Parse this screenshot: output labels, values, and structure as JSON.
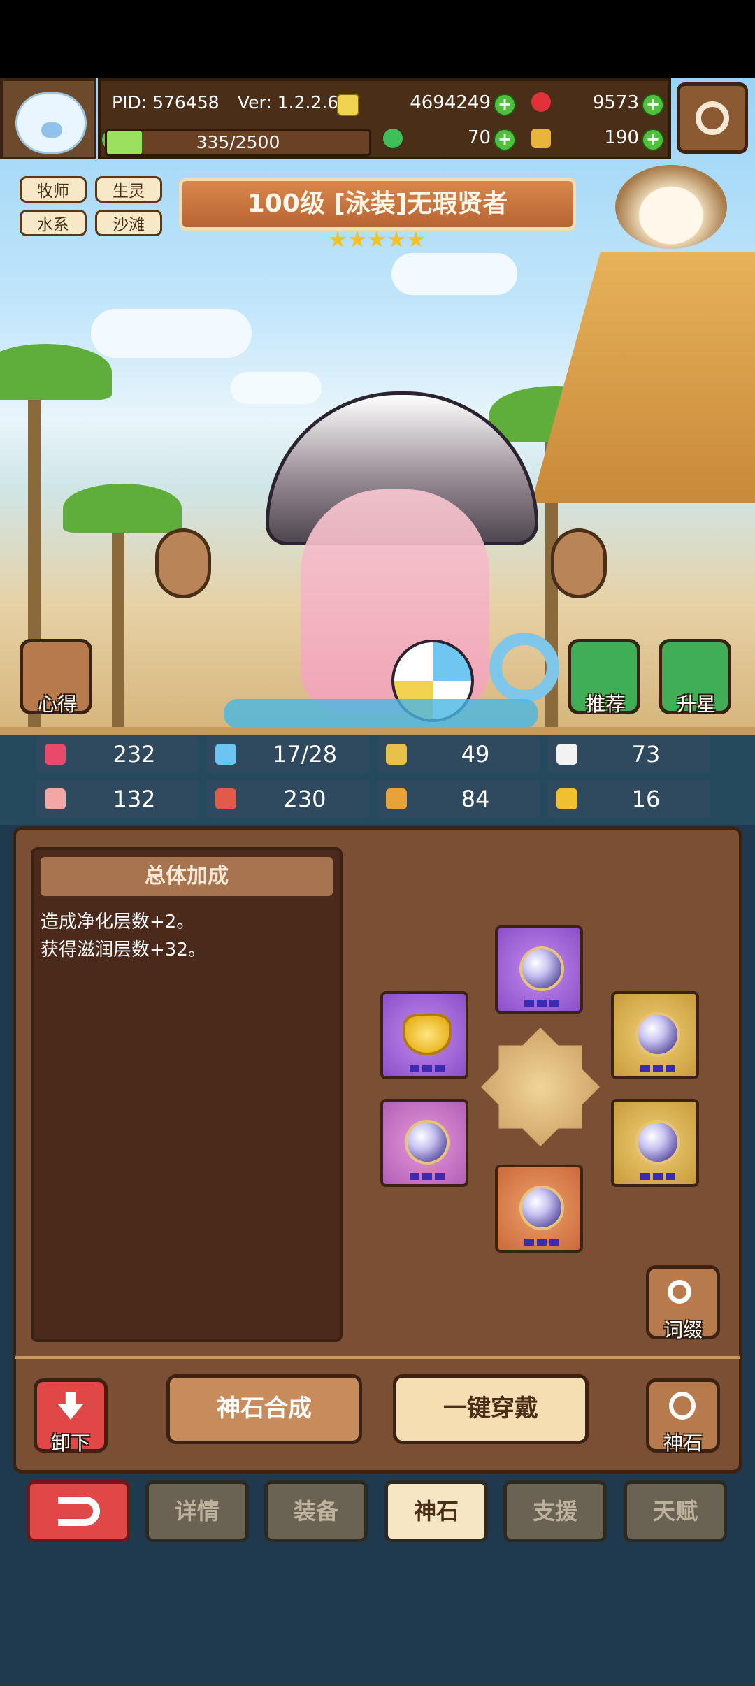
{
  "header": {
    "pid": "PID: 576458",
    "ver": "Ver: 1.2.2.6",
    "gold": "4694249",
    "gems": "9573",
    "stamina": "335/2500",
    "stamina_fraction": 0.134,
    "clover": "70",
    "food": "190",
    "plus_symbol": "+"
  },
  "tags": [
    "牧师",
    "生灵",
    "水系",
    "沙滩"
  ],
  "character": {
    "title": "100级 [泳装]无瑕贤者",
    "stars": 5
  },
  "side_buttons": {
    "insight": "心得",
    "recommend": "推荐",
    "star_up": "升星"
  },
  "stats": [
    {
      "icon": "heart-icon",
      "value": "232"
    },
    {
      "icon": "water-drop-icon",
      "value": "17/28"
    },
    {
      "icon": "shield-icon",
      "value": "49"
    },
    {
      "icon": "wing-icon",
      "value": "73"
    },
    {
      "icon": "fist-icon",
      "value": "132"
    },
    {
      "icon": "book-icon",
      "value": "230"
    },
    {
      "icon": "boot-icon",
      "value": "84"
    },
    {
      "icon": "horseshoe-icon",
      "value": "16"
    }
  ],
  "bonus": {
    "title": "总体加成",
    "lines": [
      "造成净化层数+2。",
      "获得滋润层数+32。"
    ]
  },
  "buttons": {
    "affix": "词缀",
    "unequip": "卸下",
    "synthesize": "神石合成",
    "equip_all": "一键穿戴",
    "godstone": "神石"
  },
  "tabs": [
    "详情",
    "装备",
    "神石",
    "支援",
    "天赋"
  ],
  "active_tab": "神石",
  "colors": {
    "panel": "#7a4f33",
    "accent_red": "#e04848",
    "plus_green": "#4fbf3c"
  }
}
